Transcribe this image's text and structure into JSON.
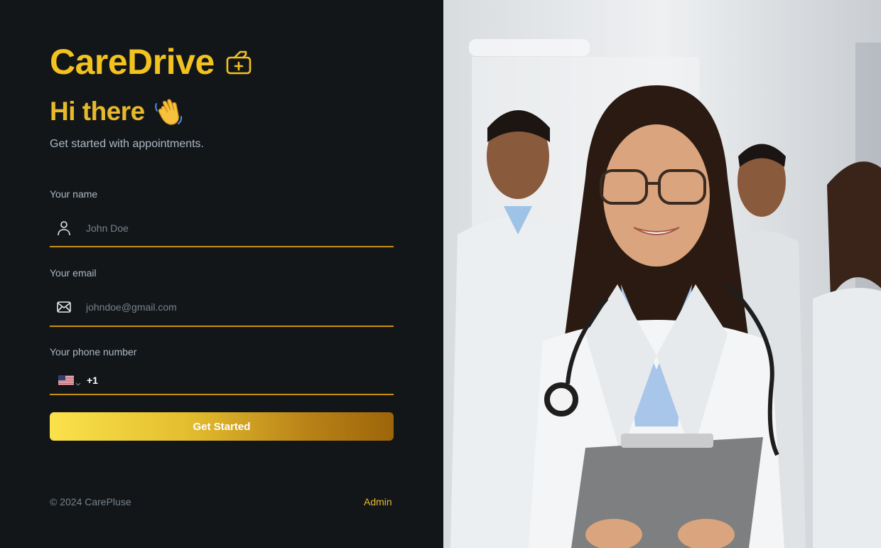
{
  "brand": {
    "name": "CareDrive",
    "icon": "medical-bag-icon",
    "color": "#f2c21f"
  },
  "hero": {
    "title": "Hi there",
    "emoji_icon": "waving-hand-icon",
    "subtitle": "Get started with appointments."
  },
  "form": {
    "name": {
      "label": "Your name",
      "placeholder": "John Doe",
      "icon": "user-icon"
    },
    "email": {
      "label": "Your email",
      "placeholder": "johndoe@gmail.com",
      "icon": "mail-icon"
    },
    "phone": {
      "label": "Your phone number",
      "country_icon": "us-flag-icon",
      "dial_code": "+1"
    },
    "submit_label": "Get Started"
  },
  "footer": {
    "copyright": "© 2024 CarePluse",
    "admin_link": "Admin"
  },
  "colors": {
    "background": "#131619",
    "accent": "#e8b92c",
    "underline": "#c8900e",
    "muted": "#abb8c4"
  },
  "floating_widget": {
    "icon": "settings-sliders-icon"
  }
}
